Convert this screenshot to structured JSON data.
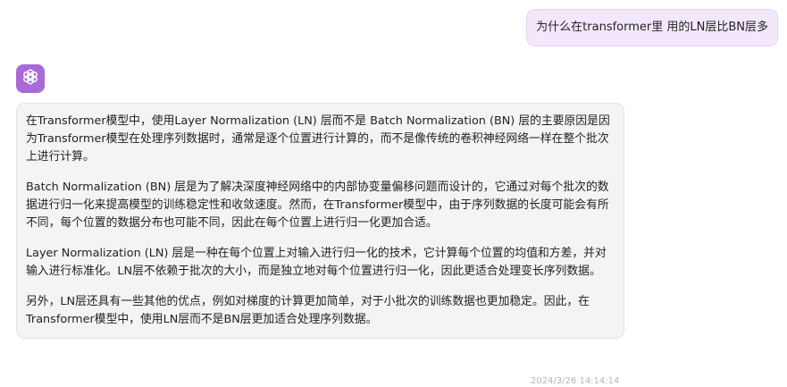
{
  "user_message": {
    "text": "为什么在transformer里 用的LN层比BN层多"
  },
  "assistant": {
    "avatar_icon": "openai-logo-icon",
    "avatar_color": "#a96ad8",
    "paragraphs": [
      "在Transformer模型中，使用Layer Normalization (LN) 层而不是 Batch Normalization (BN) 层的主要原因是因为Transformer模型在处理序列数据时，通常是逐个位置进行计算的，而不是像传统的卷积神经网络一样在整个批次上进行计算。",
      "Batch Normalization (BN) 层是为了解决深度神经网络中的内部协变量偏移问题而设计的，它通过对每个批次的数据进行归一化来提高模型的训练稳定性和收敛速度。然而，在Transformer模型中，由于序列数据的长度可能会有所不同，每个位置的数据分布也可能不同，因此在每个位置上进行归一化更加合适。",
      "Layer Normalization (LN) 层是一种在每个位置上对输入进行归一化的技术，它计算每个位置的均值和方差，并对输入进行标准化。LN层不依赖于批次的大小，而是独立地对每个位置进行归一化，因此更适合处理变长序列数据。",
      "另外，LN层还具有一些其他的优点，例如对梯度的计算更加简单，对于小批次的训练数据也更加稳定。因此，在Transformer模型中，使用LN层而不是BN层更加适合处理序列数据。"
    ],
    "timestamp": "2024/3/26 14:14:14"
  }
}
